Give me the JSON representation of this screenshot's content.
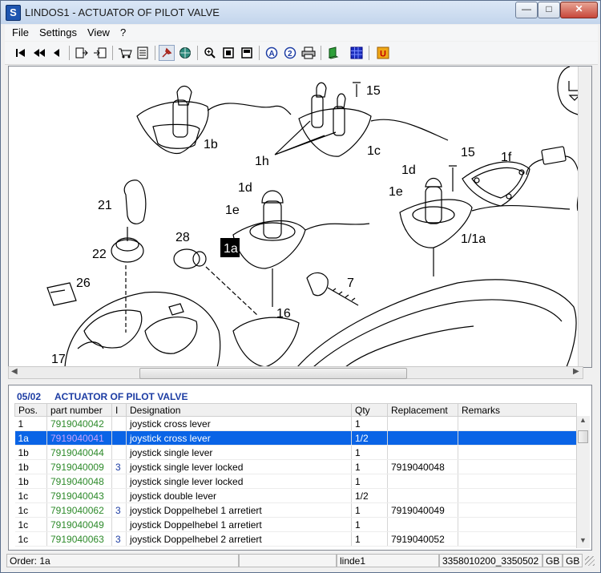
{
  "window": {
    "title": "LINDOS1 - ACTUATOR OF PILOT VALVE",
    "app_icon_glyph": "S"
  },
  "menu": [
    "File",
    "Settings",
    "View",
    "?"
  ],
  "toolbar_icons": [
    "first-icon",
    "previous-page-icon",
    "previous-icon",
    "export-icon",
    "import-icon",
    "cart-icon",
    "checklist-icon",
    "pin-icon",
    "globe-icon",
    "zoom-in-icon",
    "fit-page-icon",
    "fit-width-icon",
    "search-a-icon",
    "search-2-icon",
    "print-icon",
    "book-icon",
    "grid-icon",
    "u-icon"
  ],
  "drawing_labels": [
    "15",
    "1b",
    "1h",
    "1c",
    "15",
    "1f",
    "1d",
    "1e",
    "1d",
    "1e",
    "21",
    "28",
    "1a",
    "22",
    "26",
    "7",
    "1/1a",
    "16",
    "17"
  ],
  "parts": {
    "section_no": "05/02",
    "section_title": "ACTUATOR OF PILOT VALVE",
    "columns": [
      "Pos.",
      "part number",
      "I",
      "Designation",
      "Qty",
      "Replacement",
      "Remarks"
    ],
    "rows": [
      {
        "pos": "1",
        "part": "7919040042",
        "info": "",
        "designation": "joystick cross lever",
        "qty": "1",
        "replacement": "",
        "remarks": ""
      },
      {
        "pos": "1a",
        "part": "7919040041",
        "info": "",
        "designation": "joystick cross lever",
        "qty": "1/2",
        "replacement": "",
        "remarks": "",
        "selected": true
      },
      {
        "pos": "1b",
        "part": "7919040044",
        "info": "",
        "designation": "joystick single lever",
        "qty": "1",
        "replacement": "",
        "remarks": ""
      },
      {
        "pos": "1b",
        "part": "7919040009",
        "info": "3",
        "designation": "joystick single lever locked",
        "qty": "1",
        "replacement": "7919040048",
        "remarks": ""
      },
      {
        "pos": "1b",
        "part": "7919040048",
        "info": "",
        "designation": "joystick single lever locked",
        "qty": "1",
        "replacement": "",
        "remarks": ""
      },
      {
        "pos": "1c",
        "part": "7919040043",
        "info": "",
        "designation": "joystick double lever",
        "qty": "1/2",
        "replacement": "",
        "remarks": ""
      },
      {
        "pos": "1c",
        "part": "7919040062",
        "info": "3",
        "designation": "joystick Doppelhebel 1 arretiert",
        "qty": "1",
        "replacement": "7919040049",
        "remarks": ""
      },
      {
        "pos": "1c",
        "part": "7919040049",
        "info": "",
        "designation": "joystick Doppelhebel 1 arretiert",
        "qty": "1",
        "replacement": "",
        "remarks": ""
      },
      {
        "pos": "1c",
        "part": "7919040063",
        "info": "3",
        "designation": "joystick Doppelhebel 2 arretiert",
        "qty": "1",
        "replacement": "7919040052",
        "remarks": ""
      }
    ]
  },
  "status": {
    "order": "Order: 1a",
    "empty": "",
    "user": "linde1",
    "numbers": "3358010200_3350502",
    "lang1": "GB",
    "lang2": "GB"
  }
}
